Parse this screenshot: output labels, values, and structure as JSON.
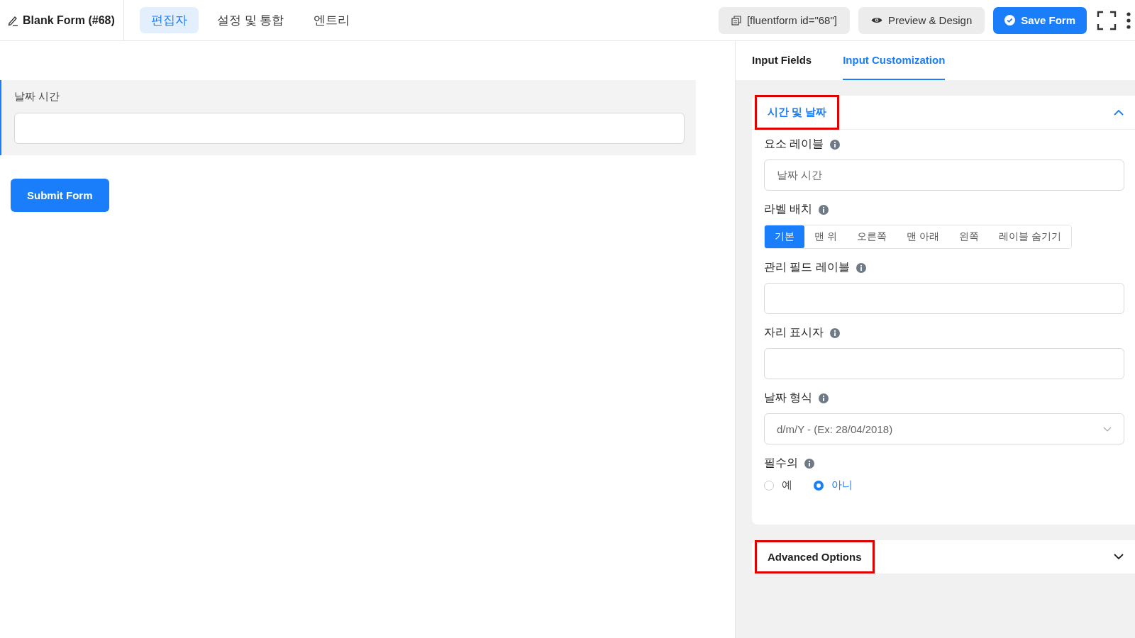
{
  "header": {
    "title": "Blank Form (#68)",
    "nav": [
      {
        "label": "편집자",
        "selected": true
      },
      {
        "label": "설정 및 통합",
        "selected": false
      },
      {
        "label": "엔트리",
        "selected": false
      }
    ],
    "shortcode": "[fluentform id=\"68\"]",
    "preview_button": "Preview & Design",
    "save_button": "Save Form"
  },
  "form": {
    "fields": [
      {
        "label": "날짜 시간",
        "selected": true
      }
    ],
    "submit_button": "Submit Form"
  },
  "panel": {
    "tabs": [
      {
        "label": "Input Fields",
        "selected": false
      },
      {
        "label": "Input Customization",
        "selected": true
      }
    ],
    "sections": [
      {
        "title": "시간 및 날짜",
        "expanded": true,
        "highlighted": true,
        "settings": [
          {
            "kind": "text",
            "label": "요소 레이블",
            "value": "날짜 시간"
          },
          {
            "kind": "segmented",
            "label": "라벨 배치",
            "options": [
              {
                "label": "기본",
                "selected": true
              },
              {
                "label": "맨 위",
                "selected": false
              },
              {
                "label": "오른쪽",
                "selected": false
              },
              {
                "label": "맨 아래",
                "selected": false
              },
              {
                "label": "왼쪽",
                "selected": false
              },
              {
                "label": "레이블 숨기기",
                "selected": false
              }
            ]
          },
          {
            "kind": "text",
            "label": "관리 필드 레이블"
          },
          {
            "kind": "text",
            "label": "자리 표시자"
          },
          {
            "kind": "select",
            "label": "날짜 형식",
            "value": "d/m/Y - (Ex: 28/04/2018)"
          },
          {
            "kind": "radio",
            "label": "필수의",
            "options": [
              {
                "label": "예",
                "selected": false
              },
              {
                "label": "아니",
                "selected": true
              }
            ]
          }
        ]
      },
      {
        "title": "Advanced Options",
        "expanded": false,
        "highlighted": true
      }
    ]
  }
}
